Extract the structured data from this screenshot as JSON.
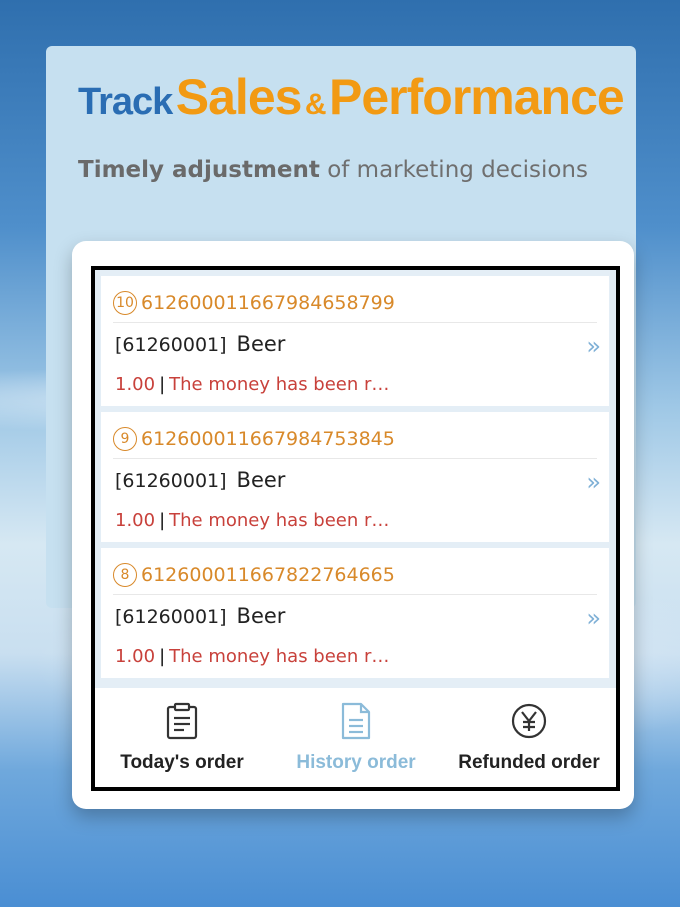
{
  "header": {
    "title_word1": "Track",
    "title_word2": "Sales",
    "title_amp": "&",
    "title_word3": "Performance",
    "subtitle_bold": "Timely adjustment",
    "subtitle_rest": " of marketing decisions"
  },
  "orders": [
    {
      "index": "10",
      "order_no": "6126000116679846587​99",
      "code": "[61260001]",
      "product": "Beer",
      "amount": "1.00",
      "status": "The money has been r…"
    },
    {
      "index": "9",
      "order_no": "612600011667984753845",
      "code": "[61260001]",
      "product": "Beer",
      "amount": "1.00",
      "status": "The money has been r…"
    },
    {
      "index": "8",
      "order_no": "612600011667822764665",
      "code": "[61260001]",
      "product": "Beer",
      "amount": "1.00",
      "status": "The money has been r…"
    }
  ],
  "tabs": [
    {
      "label": "Today's order",
      "icon": "clipboard-icon"
    },
    {
      "label": "History order",
      "icon": "document-icon"
    },
    {
      "label": "Refunded order",
      "icon": "yen-circle-icon"
    }
  ],
  "colors": {
    "accent_orange": "#f29a13",
    "title_blue": "#2a6db3",
    "active_tab": "#8bbbd9",
    "money_red": "#c8413b"
  }
}
